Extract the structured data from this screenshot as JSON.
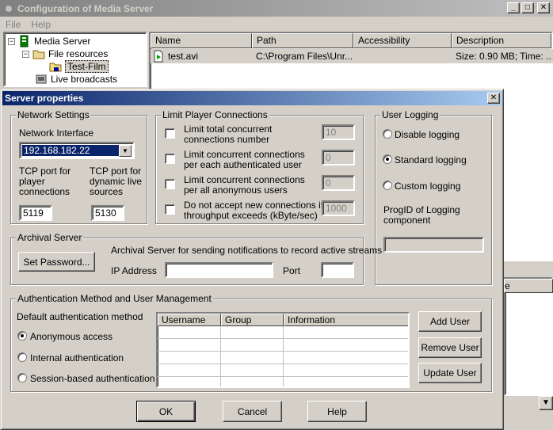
{
  "main_window": {
    "title": "Configuration of Media Server",
    "controls": {
      "minimize": "_",
      "maximize": "□",
      "close": "✕"
    },
    "menu": [
      "File",
      "Help"
    ]
  },
  "tree": {
    "root": "Media Server",
    "file_resources": "File resources",
    "selected": "Test-Film",
    "live": "Live broadcasts"
  },
  "file_list": {
    "columns": [
      "Name",
      "Path",
      "Accessibility",
      "Description"
    ],
    "rows": [
      {
        "name": "test.avi",
        "path": "C:\\Program Files\\Unr...",
        "accessibility": "",
        "description": "Size: 0.90 MB; Time: ..."
      }
    ],
    "lower_header_fragment": "e"
  },
  "dialog": {
    "title": "Server properties",
    "close": "✕",
    "network": {
      "legend": "Network Settings",
      "interface_label": "Network Interface",
      "interface_value": "192.168.182.22",
      "tcp_player_label": [
        "TCP port for",
        "player",
        "connections"
      ],
      "tcp_live_label": [
        "TCP port for",
        "dynamic live",
        "sources"
      ],
      "tcp_player_value": "5119",
      "tcp_live_value": "5130"
    },
    "limits": {
      "legend": "Limit Player Connections",
      "items": [
        {
          "label": [
            "Limit total concurrent",
            "connections number"
          ],
          "value": "10"
        },
        {
          "label": [
            "Limit concurrent connections",
            "per each authenticated user"
          ],
          "value": "0"
        },
        {
          "label": [
            "Limit concurrent connections",
            "per all anonymous users"
          ],
          "value": "0"
        },
        {
          "label": [
            "Do not accept new connections if",
            "throughput exceeds (kByte/sec)"
          ],
          "value": "1000"
        }
      ]
    },
    "logging": {
      "legend": "User Logging",
      "options": [
        "Disable logging",
        "Standard logging",
        "Custom logging"
      ],
      "selected": "Standard logging",
      "progid_label": [
        "ProgID of Logging",
        "component"
      ],
      "progid_value": ""
    },
    "archival": {
      "legend": "Archival Server",
      "set_password": "Set Password...",
      "description": "Archival Server for sending notifications to record active streams",
      "ip_label": "IP Address",
      "ip_value": "",
      "port_label": "Port",
      "port_value": ""
    },
    "auth": {
      "legend": "Authentication Method and User Management",
      "default_label": "Default authentication method",
      "options": [
        "Anonymous access",
        "Internal authentication",
        "Session-based authentication"
      ],
      "selected": "Anonymous access",
      "columns": [
        "Username",
        "Group",
        "Information"
      ],
      "add_user": "Add User",
      "remove_user": "Remove User",
      "update_user": "Update User"
    },
    "buttons": {
      "ok": "OK",
      "cancel": "Cancel",
      "help": "Help"
    }
  }
}
